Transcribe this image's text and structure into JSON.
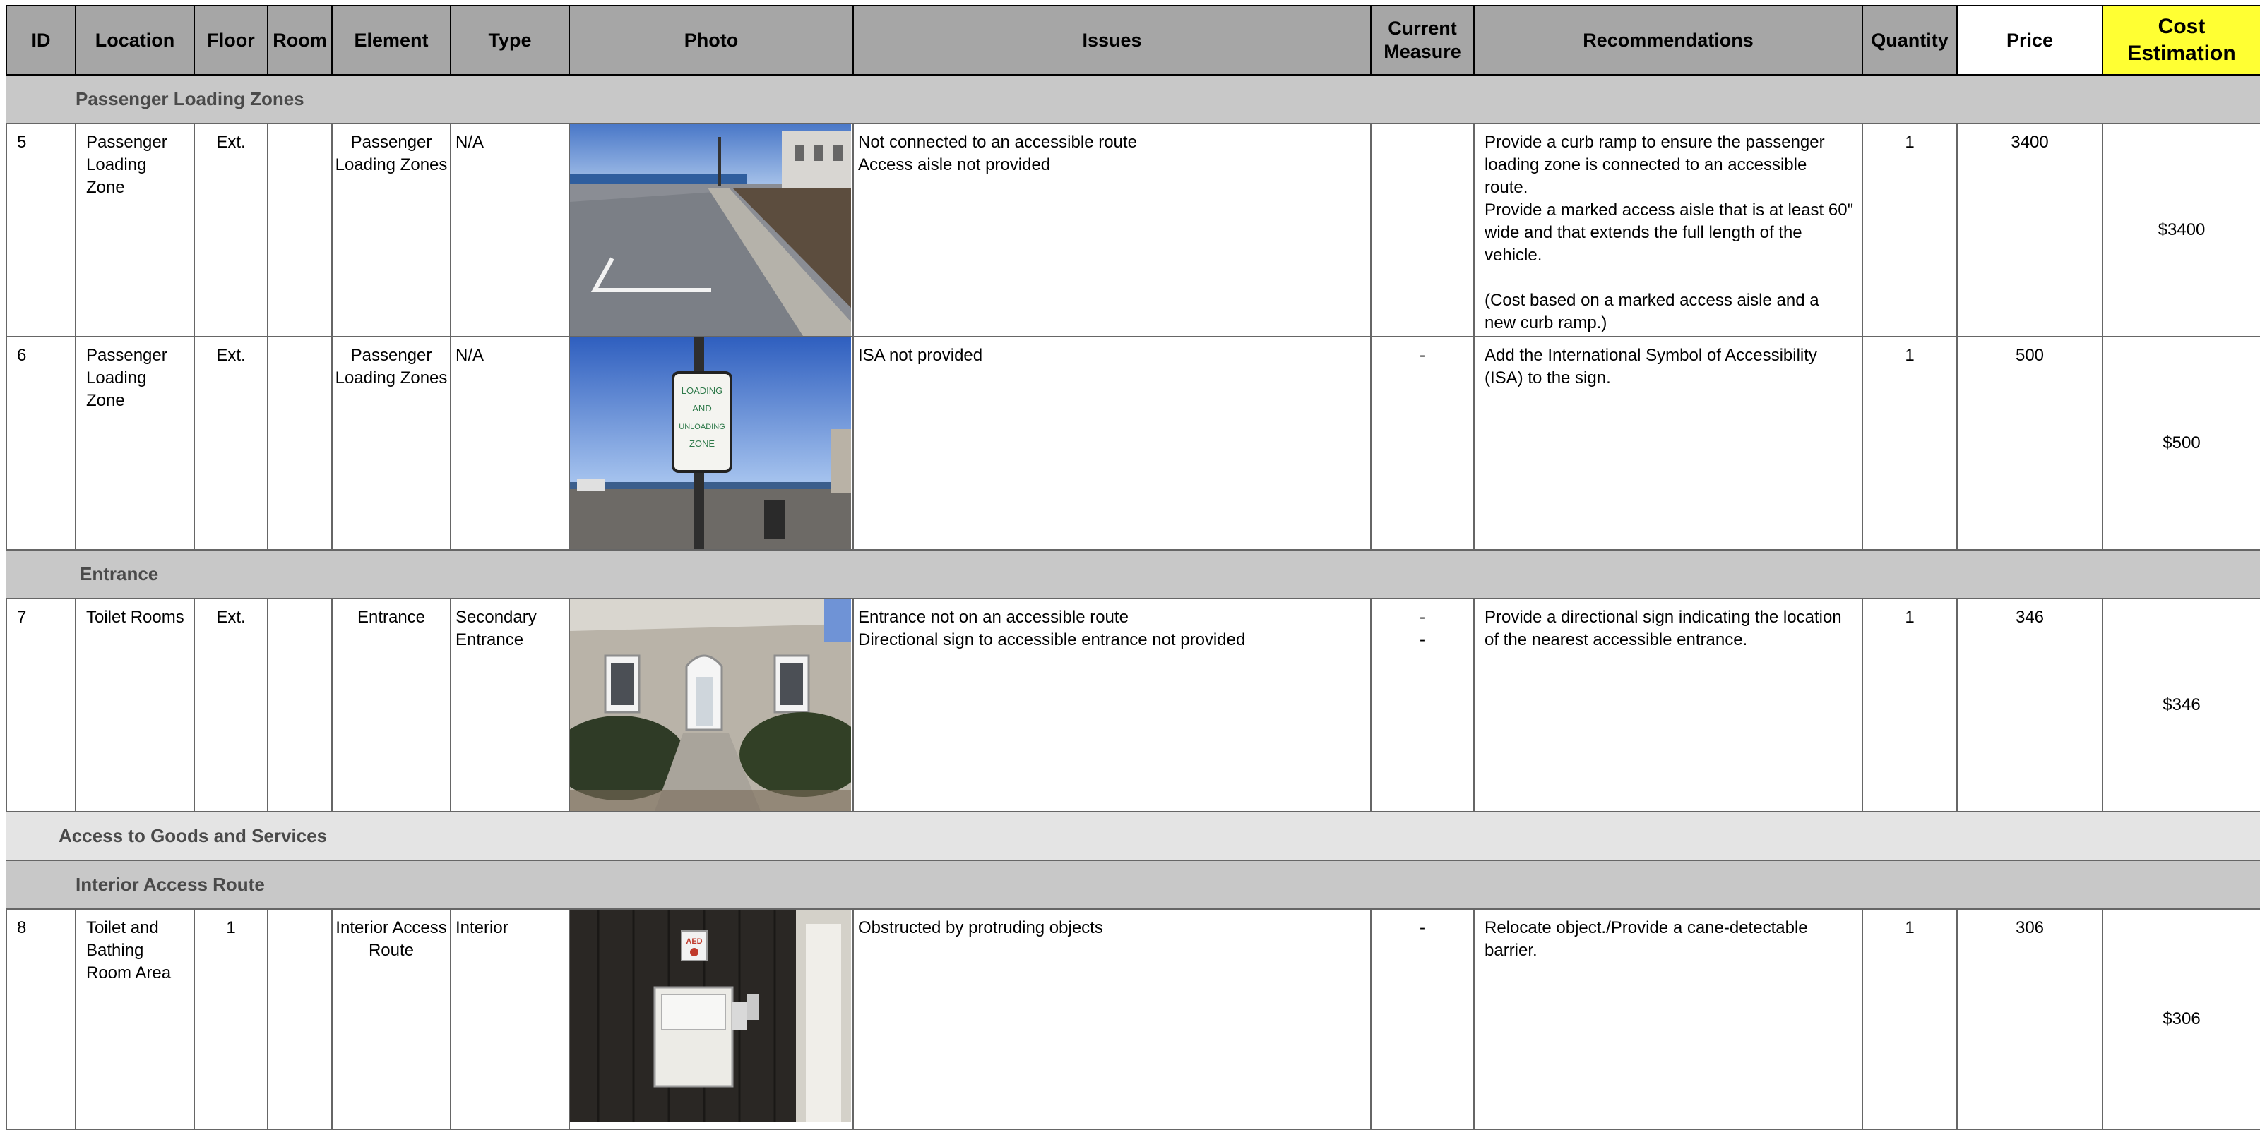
{
  "headers": {
    "id": "ID",
    "location": "Location",
    "floor": "Floor",
    "room": "Room",
    "element": "Element",
    "type": "Type",
    "photo": "Photo",
    "issues": "Issues",
    "current_measure": "Current Measure",
    "recommendations": "Recommendations",
    "quantity": "Quantity",
    "price": "Price",
    "cost_estimation": "Cost Estimation"
  },
  "sections": {
    "passenger_loading": "Passenger Loading Zones",
    "entrance": "Entrance",
    "access_goods": "Access to Goods and Services",
    "interior_route": "Interior Access Route"
  },
  "rows": [
    {
      "id": "5",
      "location": "Passenger Loading Zone",
      "floor": "Ext.",
      "room": "",
      "element": "Passenger Loading Zones",
      "type": "N/A",
      "photo_icon": "photo-parking-lot-curb",
      "issues": [
        "Not connected to an accessible route",
        "Access aisle not provided"
      ],
      "current_measure": [],
      "recommendations": [
        "Provide a curb ramp to ensure the passenger loading zone is connected to an accessible route.",
        "Provide a marked access aisle that is at least 60\" wide and that extends the full length of the vehicle.",
        "(Cost based on a marked access aisle and a new curb ramp.)"
      ],
      "quantity": "1",
      "price": "3400",
      "cost": "$3400"
    },
    {
      "id": "6",
      "location": "Passenger Loading Zone",
      "floor": "Ext.",
      "room": "",
      "element": "Passenger Loading Zones",
      "type": "N/A",
      "photo_icon": "photo-loading-zone-sign",
      "sign_text": [
        "LOADING",
        "AND",
        "UNLOADING",
        "ZONE"
      ],
      "issues": [
        "ISA not provided"
      ],
      "current_measure": [
        "-"
      ],
      "recommendations": [
        "Add the International Symbol of Accessibility (ISA) to the sign."
      ],
      "quantity": "1",
      "price": "500",
      "cost": "$500"
    },
    {
      "id": "7",
      "location": "Toilet Rooms",
      "floor": "Ext.",
      "room": "",
      "element": "Entrance",
      "type": "Secondary Entrance",
      "photo_icon": "photo-building-entrance",
      "issues": [
        "Entrance not on an accessible route",
        "Directional sign to accessible entrance not provided"
      ],
      "current_measure": [
        "-",
        "-"
      ],
      "recommendations": [
        "Provide a directional sign indicating the location of the nearest accessible entrance."
      ],
      "quantity": "1",
      "price": "346",
      "cost": "$346"
    },
    {
      "id": "8",
      "location": "Toilet and Bathing Room Area",
      "floor": "1",
      "room": "",
      "element": "Interior Access Route",
      "type": "Interior",
      "photo_icon": "photo-protruding-object",
      "sign_text": [
        "AED"
      ],
      "issues": [
        "Obstructed by protruding objects"
      ],
      "current_measure": [
        "-"
      ],
      "recommendations": [
        "Relocate object./Provide a cane-detectable barrier."
      ],
      "quantity": "1",
      "price": "306",
      "cost": "$306"
    }
  ],
  "colors": {
    "header_bg": "#a6a6a6",
    "cost_header_bg": "#ffff33",
    "section_bg": "#c8c8c8",
    "section_light_bg": "#e4e4e4"
  }
}
